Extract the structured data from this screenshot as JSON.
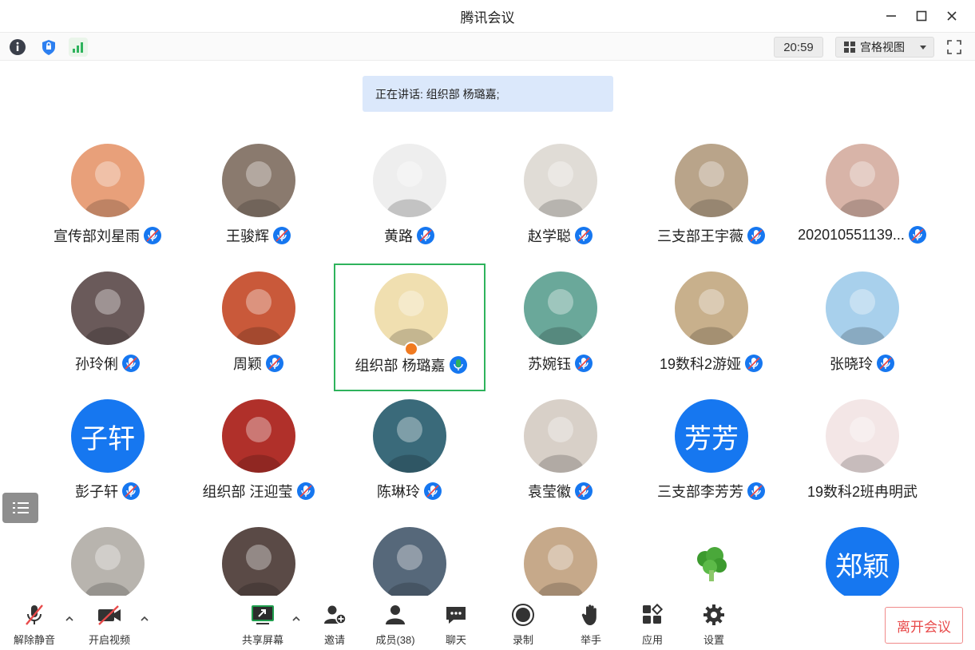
{
  "window": {
    "title": "腾讯会议"
  },
  "infobar": {
    "timer": "20:59",
    "view_mode": "宫格视图"
  },
  "speaking": {
    "text": "正在讲话: 组织部 杨璐嘉;"
  },
  "participants": [
    {
      "name": "宣传部刘星雨",
      "avatar": "photo",
      "color": "#e8a07a"
    },
    {
      "name": "王骏辉",
      "avatar": "photo",
      "color": "#8a7a6e"
    },
    {
      "name": "黄路",
      "avatar": "cat-drawing",
      "color": "#eeeeee"
    },
    {
      "name": "赵学聪",
      "avatar": "drawing",
      "color": "#e0dcd6"
    },
    {
      "name": "三支部王宇薇",
      "avatar": "dog-photo",
      "color": "#b9a48a"
    },
    {
      "name": "202010551139...",
      "avatar": "photo",
      "color": "#d8b4a8"
    },
    {
      "name": "孙玲俐",
      "avatar": "photo",
      "color": "#6a5a5a"
    },
    {
      "name": "周颖",
      "avatar": "photo",
      "color": "#c9593a"
    },
    {
      "name": "组织部 杨璐嘉",
      "avatar": "anime",
      "color": "#f0dfb0",
      "active": true
    },
    {
      "name": "苏婉钰",
      "avatar": "art",
      "color": "#6aa89a"
    },
    {
      "name": "19数科2游娅",
      "avatar": "photo",
      "color": "#c8b08c"
    },
    {
      "name": "张晓玲",
      "avatar": "photo",
      "color": "#a8d0ec"
    },
    {
      "name": "彭子轩",
      "avatar": "text",
      "text": "子轩"
    },
    {
      "name": "组织部 汪迎莹",
      "avatar": "photo",
      "color": "#b0302a"
    },
    {
      "name": "陈琳玲",
      "avatar": "photo",
      "color": "#3a6a7a"
    },
    {
      "name": "袁莹徽",
      "avatar": "photo",
      "color": "#d8d0c8"
    },
    {
      "name": "三支部李芳芳",
      "avatar": "text",
      "text": "芳芳"
    },
    {
      "name": "19数科2班冉明武",
      "avatar": "doll",
      "color": "#f3e6e6",
      "no_mic": true
    },
    {
      "name": "",
      "avatar": "drawing",
      "color": "#b8b4ae"
    },
    {
      "name": "",
      "avatar": "photo",
      "color": "#5a4a46"
    },
    {
      "name": "",
      "avatar": "art",
      "color": "#56687a"
    },
    {
      "name": "",
      "avatar": "cat-photo",
      "color": "#c6a98a"
    },
    {
      "name": "",
      "avatar": "broccoli",
      "color": "#4aa83a"
    },
    {
      "name": "",
      "avatar": "text",
      "text": "郑颖"
    }
  ],
  "toolbar": {
    "unmute": "解除静音",
    "start_video": "开启视频",
    "share_screen": "共享屏幕",
    "invite": "邀请",
    "members": "成员(38)",
    "chat": "聊天",
    "record": "录制",
    "raise_hand": "举手",
    "apps": "应用",
    "settings": "设置",
    "leave": "离开会议"
  },
  "colors": {
    "accent": "#1677f0",
    "active_border": "#2eb35c",
    "leave": "#e84a4a",
    "banner": "#dbe8fb"
  }
}
